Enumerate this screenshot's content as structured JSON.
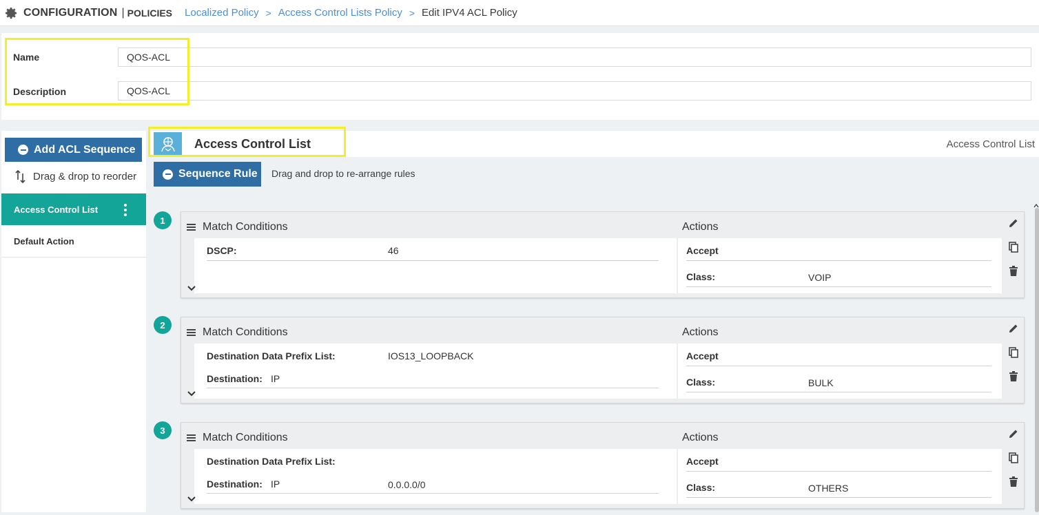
{
  "header": {
    "brand": "CONFIGURATION",
    "separator": "|",
    "section": "POLICIES",
    "breadcrumbs": [
      {
        "label": "Localized Policy"
      },
      {
        "label": "Access Control Lists Policy"
      },
      {
        "label": "Edit IPV4 ACL Policy"
      }
    ],
    "crumb_arrow": ">"
  },
  "form": {
    "name_label": "Name",
    "name_value": "QOS-ACL",
    "description_label": "Description",
    "description_value": "QOS-ACL"
  },
  "sidebar": {
    "add_button": "Add ACL Sequence",
    "drag_reorder": "Drag & drop to reorder",
    "items": [
      {
        "label": "Access Control List"
      },
      {
        "label": "Default Action"
      }
    ]
  },
  "main": {
    "title": "Access Control List",
    "right_title": "Access Control List",
    "sequence_button": "Sequence Rule",
    "hint": "Drag and drop to re-arrange rules"
  },
  "rules": [
    {
      "number": "1",
      "mc_title": "Match Conditions",
      "actions_title": "Actions",
      "conditions": [
        {
          "label": "DSCP:",
          "value": "46",
          "extra": ""
        }
      ],
      "action": "Accept",
      "class_label": "Class:",
      "class_value": "VOIP"
    },
    {
      "number": "2",
      "mc_title": "Match Conditions",
      "actions_title": "Actions",
      "conditions": [
        {
          "label": "Destination Data Prefix List:",
          "value": "IOS13_LOOPBACK",
          "extra": ""
        },
        {
          "label": "Destination:",
          "value": "",
          "extra": "IP"
        }
      ],
      "action": "Accept",
      "class_label": "Class:",
      "class_value": "BULK"
    },
    {
      "number": "3",
      "mc_title": "Match Conditions",
      "actions_title": "Actions",
      "conditions": [
        {
          "label": "Destination Data Prefix List:",
          "value": "",
          "extra": ""
        },
        {
          "label": "Destination:",
          "value": "0.0.0.0/0",
          "extra": "IP"
        }
      ],
      "action": "Accept",
      "class_label": "Class:",
      "class_value": "OTHERS"
    }
  ],
  "colors": {
    "primary_button": "#2f6ea5",
    "teal": "#14a599",
    "link": "#4a90d9",
    "highlight": "#f2ef2a"
  }
}
